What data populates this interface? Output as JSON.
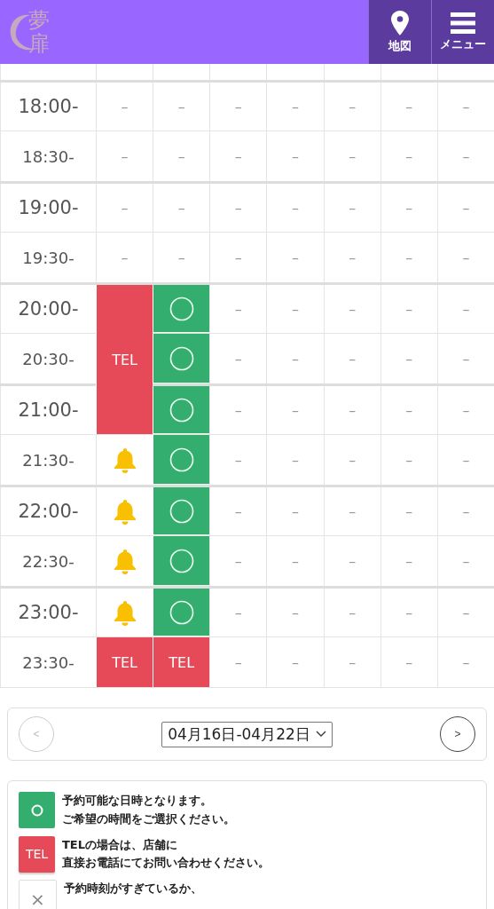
{
  "header": {
    "logo": {
      "text": "夢扉"
    },
    "buttons": [
      {
        "kind": "map",
        "label": "地図"
      },
      {
        "kind": "menu",
        "label": "メニュー"
      }
    ]
  },
  "schedule": {
    "rows": [
      {
        "time": "18:00-",
        "hour": true,
        "cells": [
          {
            "kind": "dash",
            "text": "–"
          },
          {
            "kind": "dash",
            "text": "–"
          },
          {
            "kind": "dash",
            "text": "–"
          },
          {
            "kind": "dash",
            "text": "–"
          },
          {
            "kind": "dash",
            "text": "–"
          },
          {
            "kind": "dash",
            "text": "–"
          },
          {
            "kind": "dash",
            "text": "–"
          }
        ]
      },
      {
        "time": "18:30-",
        "hour": false,
        "cells": [
          {
            "kind": "dash",
            "text": "–"
          },
          {
            "kind": "dash",
            "text": "–"
          },
          {
            "kind": "dash",
            "text": "–"
          },
          {
            "kind": "dash",
            "text": "–"
          },
          {
            "kind": "dash",
            "text": "–"
          },
          {
            "kind": "dash",
            "text": "–"
          },
          {
            "kind": "dash",
            "text": "–"
          }
        ]
      },
      {
        "time": "19:00-",
        "hour": true,
        "cells": [
          {
            "kind": "dash",
            "text": "–"
          },
          {
            "kind": "dash",
            "text": "–"
          },
          {
            "kind": "dash",
            "text": "–"
          },
          {
            "kind": "dash",
            "text": "–"
          },
          {
            "kind": "dash",
            "text": "–"
          },
          {
            "kind": "dash",
            "text": "–"
          },
          {
            "kind": "dash",
            "text": "–"
          }
        ]
      },
      {
        "time": "19:30-",
        "hour": false,
        "cells": [
          {
            "kind": "dash",
            "text": "–"
          },
          {
            "kind": "dash",
            "text": "–"
          },
          {
            "kind": "dash",
            "text": "–"
          },
          {
            "kind": "dash",
            "text": "–"
          },
          {
            "kind": "dash",
            "text": "–"
          },
          {
            "kind": "dash",
            "text": "–"
          },
          {
            "kind": "dash",
            "text": "–"
          }
        ]
      },
      {
        "time": "20:00-",
        "hour": true,
        "cells": [
          {
            "kind": "tel",
            "joined_below": true
          },
          {
            "kind": "ok"
          },
          {
            "kind": "dash",
            "text": "–"
          },
          {
            "kind": "dash",
            "text": "–"
          },
          {
            "kind": "dash",
            "text": "–"
          },
          {
            "kind": "dash",
            "text": "–"
          },
          {
            "kind": "dash",
            "text": "–"
          }
        ]
      },
      {
        "time": "20:30-",
        "hour": false,
        "cells": [
          {
            "kind": "tel",
            "text": "TEL",
            "joined_below": true
          },
          {
            "kind": "ok"
          },
          {
            "kind": "dash",
            "text": "–"
          },
          {
            "kind": "dash",
            "text": "–"
          },
          {
            "kind": "dash",
            "text": "–"
          },
          {
            "kind": "dash",
            "text": "–"
          },
          {
            "kind": "dash",
            "text": "–"
          }
        ]
      },
      {
        "time": "21:00-",
        "hour": true,
        "cells": [
          {
            "kind": "tel",
            "joined_below": false
          },
          {
            "kind": "ok"
          },
          {
            "kind": "dash",
            "text": "–"
          },
          {
            "kind": "dash",
            "text": "–"
          },
          {
            "kind": "dash",
            "text": "–"
          },
          {
            "kind": "dash",
            "text": "–"
          },
          {
            "kind": "dash",
            "text": "–"
          }
        ]
      },
      {
        "time": "21:30-",
        "hour": false,
        "cells": [
          {
            "kind": "bell"
          },
          {
            "kind": "ok"
          },
          {
            "kind": "dash",
            "text": "–"
          },
          {
            "kind": "dash",
            "text": "–"
          },
          {
            "kind": "dash",
            "text": "–"
          },
          {
            "kind": "dash",
            "text": "–"
          },
          {
            "kind": "dash",
            "text": "–"
          }
        ]
      },
      {
        "time": "22:00-",
        "hour": true,
        "cells": [
          {
            "kind": "bell"
          },
          {
            "kind": "ok"
          },
          {
            "kind": "dash",
            "text": "–"
          },
          {
            "kind": "dash",
            "text": "–"
          },
          {
            "kind": "dash",
            "text": "–"
          },
          {
            "kind": "dash",
            "text": "–"
          },
          {
            "kind": "dash",
            "text": "–"
          }
        ]
      },
      {
        "time": "22:30-",
        "hour": false,
        "cells": [
          {
            "kind": "bell"
          },
          {
            "kind": "ok"
          },
          {
            "kind": "dash",
            "text": "–"
          },
          {
            "kind": "dash",
            "text": "–"
          },
          {
            "kind": "dash",
            "text": "–"
          },
          {
            "kind": "dash",
            "text": "–"
          },
          {
            "kind": "dash",
            "text": "–"
          }
        ]
      },
      {
        "time": "23:00-",
        "hour": true,
        "cells": [
          {
            "kind": "bell"
          },
          {
            "kind": "ok"
          },
          {
            "kind": "dash",
            "text": "–"
          },
          {
            "kind": "dash",
            "text": "–"
          },
          {
            "kind": "dash",
            "text": "–"
          },
          {
            "kind": "dash",
            "text": "–"
          },
          {
            "kind": "dash",
            "text": "–"
          }
        ]
      },
      {
        "time": "23:30-",
        "hour": false,
        "cells": [
          {
            "kind": "tel",
            "text": "TEL",
            "joined_below": false
          },
          {
            "kind": "tel",
            "text": "TEL",
            "joined_below": false
          },
          {
            "kind": "dash",
            "text": "–"
          },
          {
            "kind": "dash",
            "text": "–"
          },
          {
            "kind": "dash",
            "text": "–"
          },
          {
            "kind": "dash",
            "text": "–"
          },
          {
            "kind": "dash",
            "text": "–"
          }
        ]
      }
    ]
  },
  "week_nav": {
    "prev": {
      "label": "<",
      "disabled": true
    },
    "range": "04月16日-04月22日",
    "next": {
      "label": ">",
      "disabled": false
    }
  },
  "legend": [
    {
      "kind": "ok",
      "lines": [
        "予約可能な日時となります。",
        "ご希望の時間をご選択ください。"
      ]
    },
    {
      "kind": "tel",
      "mark": "TEL",
      "lines": [
        "TELの場合は、店舗に",
        "直接お電話にてお問い合わせください。"
      ]
    },
    {
      "kind": "closed",
      "mark": "×",
      "lines": [
        "予約時刻がすぎているか、"
      ]
    }
  ]
}
